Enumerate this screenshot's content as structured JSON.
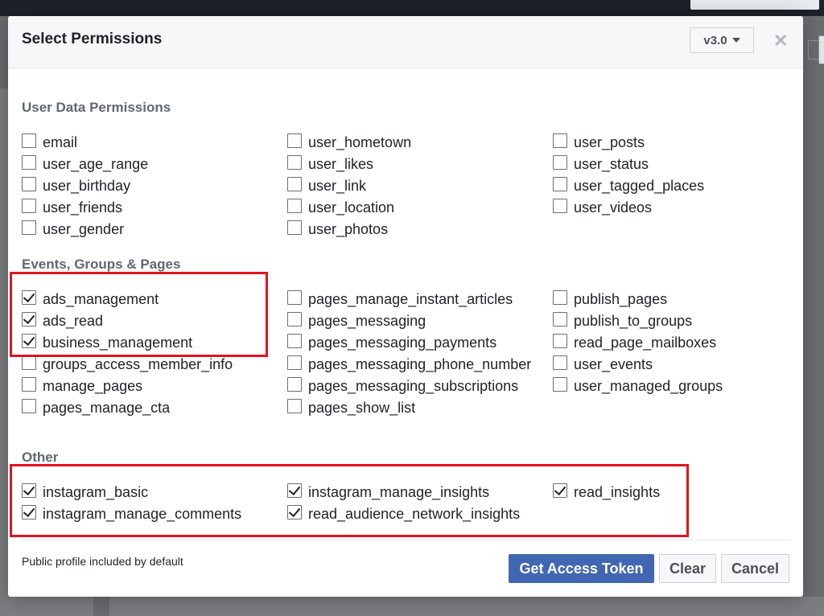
{
  "modal": {
    "title": "Select Permissions",
    "version": "v3.0",
    "close_glyph": "✕"
  },
  "sections": {
    "user_data": {
      "title": "User Data Permissions",
      "items": [
        {
          "label": "email",
          "checked": false
        },
        {
          "label": "user_age_range",
          "checked": false
        },
        {
          "label": "user_birthday",
          "checked": false
        },
        {
          "label": "user_friends",
          "checked": false
        },
        {
          "label": "user_gender",
          "checked": false
        },
        {
          "label": "user_hometown",
          "checked": false
        },
        {
          "label": "user_likes",
          "checked": false
        },
        {
          "label": "user_link",
          "checked": false
        },
        {
          "label": "user_location",
          "checked": false
        },
        {
          "label": "user_photos",
          "checked": false
        },
        {
          "label": "user_posts",
          "checked": false
        },
        {
          "label": "user_status",
          "checked": false
        },
        {
          "label": "user_tagged_places",
          "checked": false
        },
        {
          "label": "user_videos",
          "checked": false
        }
      ]
    },
    "events": {
      "title": "Events, Groups & Pages",
      "items": [
        {
          "label": "ads_management",
          "checked": true
        },
        {
          "label": "ads_read",
          "checked": true
        },
        {
          "label": "business_management",
          "checked": true
        },
        {
          "label": "groups_access_member_info",
          "checked": false
        },
        {
          "label": "manage_pages",
          "checked": false
        },
        {
          "label": "pages_manage_cta",
          "checked": false
        },
        {
          "label": "pages_manage_instant_articles",
          "checked": false
        },
        {
          "label": "pages_messaging",
          "checked": false
        },
        {
          "label": "pages_messaging_payments",
          "checked": false
        },
        {
          "label": "pages_messaging_phone_number",
          "checked": false
        },
        {
          "label": "pages_messaging_subscriptions",
          "checked": false
        },
        {
          "label": "pages_show_list",
          "checked": false
        },
        {
          "label": "publish_pages",
          "checked": false
        },
        {
          "label": "publish_to_groups",
          "checked": false
        },
        {
          "label": "read_page_mailboxes",
          "checked": false
        },
        {
          "label": "user_events",
          "checked": false
        },
        {
          "label": "user_managed_groups",
          "checked": false
        }
      ]
    },
    "other": {
      "title": "Other",
      "items": [
        {
          "label": "instagram_basic",
          "checked": true
        },
        {
          "label": "instagram_manage_comments",
          "checked": true
        },
        {
          "label": "instagram_manage_insights",
          "checked": true
        },
        {
          "label": "read_audience_network_insights",
          "checked": true
        },
        {
          "label": "read_insights",
          "checked": true
        }
      ]
    }
  },
  "footer": {
    "note": "Public profile included by default",
    "get_token_label": "Get Access Token",
    "clear_label": "Clear",
    "cancel_label": "Cancel"
  },
  "colors": {
    "primary": "#4267b2",
    "highlight": "#e0141e"
  }
}
